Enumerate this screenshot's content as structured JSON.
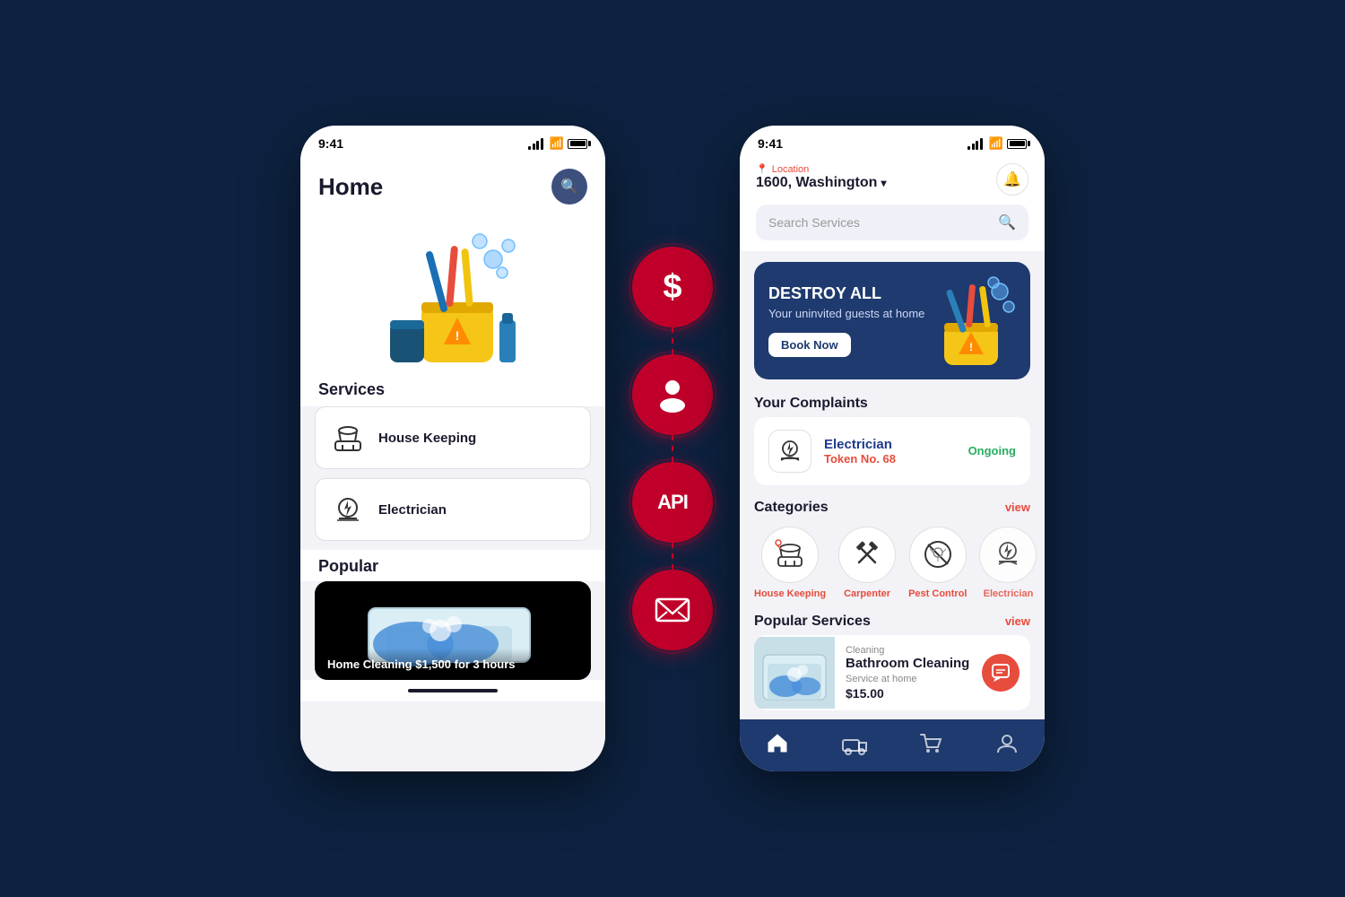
{
  "background": "#0d2240",
  "phone1": {
    "status_time": "9:41",
    "title": "Home",
    "services_section": "Services",
    "popular_section": "Popular",
    "services": [
      {
        "name": "House Keeping",
        "icon": "🧹"
      },
      {
        "name": "Electrician",
        "icon": "⚡"
      }
    ],
    "popular_card": {
      "text": "Home Cleaning $1,500 for 3 hours"
    }
  },
  "center": {
    "circles": [
      {
        "icon": "$",
        "type": "dollar"
      },
      {
        "icon": "👤",
        "type": "user"
      },
      {
        "icon": "API",
        "type": "api"
      },
      {
        "icon": "✉",
        "type": "mail"
      }
    ]
  },
  "phone2": {
    "status_time": "9:41",
    "location_label": "Location",
    "location_name": "1600, Washington",
    "search_placeholder": "Search Services",
    "banner": {
      "title": "DESTROY ALL",
      "subtitle": "Your uninvited guests at home",
      "button": "Book Now"
    },
    "complaints_section": "Your Complaints",
    "complaint": {
      "name": "Electrician",
      "token_label": "Token No.",
      "token_number": "68",
      "status": "Ongoing"
    },
    "categories_section": "Categories",
    "categories_view": "view",
    "categories": [
      {
        "label": "House Keeping",
        "icon": "🧹"
      },
      {
        "label": "Carpenter",
        "icon": "🔨"
      },
      {
        "label": "Pest Control",
        "icon": "🚫"
      },
      {
        "label": "Electrician",
        "icon": "🔧"
      }
    ],
    "popular_section": "Popular Services",
    "popular_view": "view",
    "popular_service": {
      "category": "Cleaning",
      "name": "Bathroom Cleaning",
      "subtitle": "Service at home",
      "price": "$15.00"
    },
    "nav": {
      "items": [
        "home",
        "delivery",
        "cart",
        "profile"
      ]
    }
  }
}
